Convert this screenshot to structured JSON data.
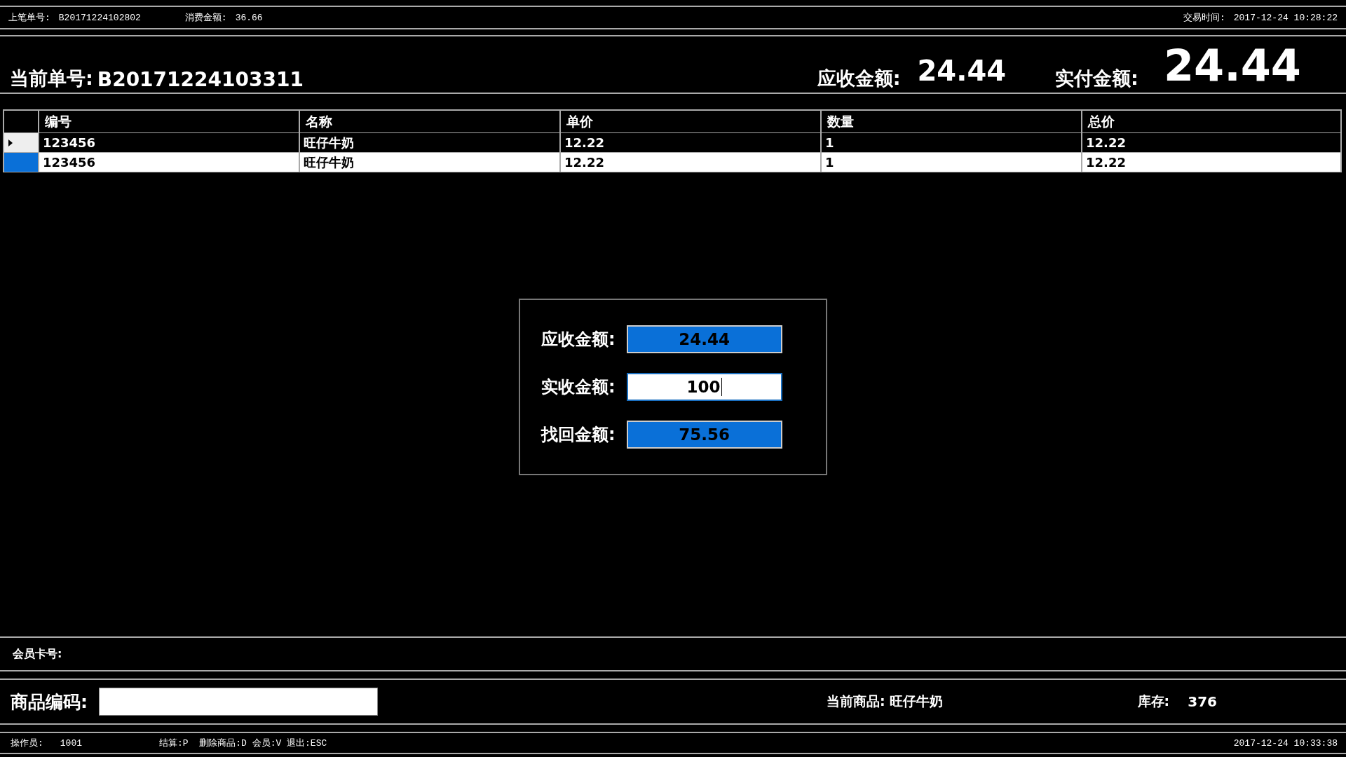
{
  "top_bar": {
    "last_order_label": "上笔单号:",
    "last_order": "B20171224102802",
    "spent_label": "消费金额:",
    "spent": "36.66",
    "time_label": "交易时间:",
    "time": "2017-12-24 10:28:22"
  },
  "header": {
    "order_label": "当前单号:",
    "order": "B20171224103311",
    "due_label": "应收金额:",
    "due": "24.44",
    "paid_label": "实付金额:",
    "paid": "24.44"
  },
  "table": {
    "columns": [
      "编号",
      "名称",
      "单价",
      "数量",
      "总价"
    ],
    "rows": [
      {
        "cells": [
          "123456",
          "旺仔牛奶",
          "12.22",
          "1",
          "12.22"
        ],
        "current": true,
        "selected": false
      },
      {
        "cells": [
          "123456",
          "旺仔牛奶",
          "12.22",
          "1",
          "12.22"
        ],
        "current": false,
        "selected": true
      }
    ]
  },
  "payment_dialog": {
    "fields": [
      {
        "label": "应收金额:",
        "value": "24.44",
        "kind": "readonly"
      },
      {
        "label": "实收金额:",
        "value": "100",
        "kind": "input"
      },
      {
        "label": "找回金额:",
        "value": "75.56",
        "kind": "readonly"
      }
    ]
  },
  "member_bar": {
    "card_label": "会员卡号:"
  },
  "product_bar": {
    "code_label": "商品编码:",
    "current_label": "当前商品:",
    "current": "旺仔牛奶",
    "stock_label": "库存:",
    "stock": "376"
  },
  "status_bar": {
    "operator_label": "操作员:",
    "operator": "1001",
    "shortcuts": "结算:P  删除商品:D 会员:V 退出:ESC",
    "time": "2017-12-24 10:33:38"
  }
}
